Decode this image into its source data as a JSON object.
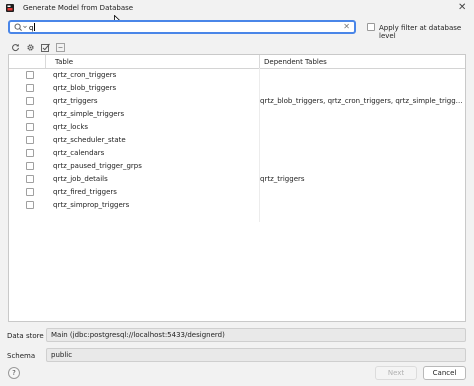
{
  "window": {
    "title": "Generate Model from Database",
    "close_glyph": "✕"
  },
  "search": {
    "value": "q",
    "clear_glyph": "✕"
  },
  "filter": {
    "label": "Apply filter at database level",
    "checked": false
  },
  "toolbar": {
    "icons": [
      "refresh-icon",
      "settings-icon",
      "select-all-icon",
      "deselect-all-icon"
    ]
  },
  "table": {
    "columns": [
      "Table",
      "Dependent Tables"
    ],
    "rows": [
      {
        "table": "qrtz_cron_triggers",
        "dependent": ""
      },
      {
        "table": "qrtz_blob_triggers",
        "dependent": ""
      },
      {
        "table": "qrtz_triggers",
        "dependent": "qrtz_blob_triggers, qrtz_cron_triggers, qrtz_simple_triggers, qrtz_si..."
      },
      {
        "table": "qrtz_simple_triggers",
        "dependent": ""
      },
      {
        "table": "qrtz_locks",
        "dependent": ""
      },
      {
        "table": "qrtz_scheduler_state",
        "dependent": ""
      },
      {
        "table": "qrtz_calendars",
        "dependent": ""
      },
      {
        "table": "qrtz_paused_trigger_grps",
        "dependent": ""
      },
      {
        "table": "qrtz_job_details",
        "dependent": "qrtz_triggers"
      },
      {
        "table": "qrtz_fired_triggers",
        "dependent": ""
      },
      {
        "table": "qrtz_simprop_triggers",
        "dependent": ""
      }
    ]
  },
  "datastore": {
    "label": "Data store",
    "value": "Main (jdbc:postgresql://localhost:5433/designerd)"
  },
  "schema": {
    "label": "Schema",
    "value": "public"
  },
  "footer": {
    "help_label": "?",
    "next_label": "Next",
    "cancel_label": "Cancel"
  },
  "colors": {
    "focus_border": "#4a86e8",
    "background": "#f2f2f2"
  }
}
